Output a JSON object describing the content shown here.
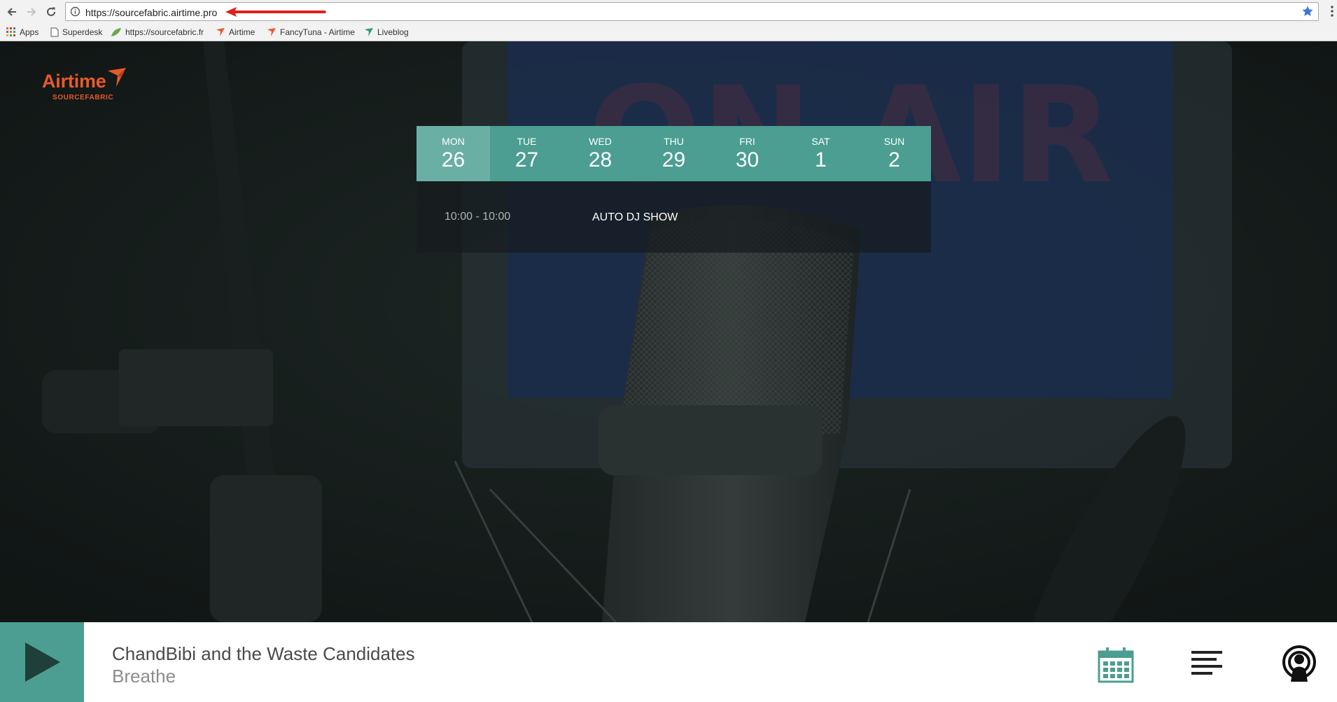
{
  "browser": {
    "url": "https://sourcefabric.airtime.pro",
    "bookmarks": [
      {
        "label": "Apps",
        "icon": "apps-grid-icon"
      },
      {
        "label": "Superdesk",
        "icon": "page-icon"
      },
      {
        "label": "https://sourcefabric.fr",
        "icon": "leaf-icon"
      },
      {
        "label": "Airtime",
        "icon": "airtime-icon"
      },
      {
        "label": "FancyTuna - Airtime",
        "icon": "airtime-icon"
      },
      {
        "label": "Liveblog",
        "icon": "liveblog-icon"
      }
    ]
  },
  "logo": {
    "name": "Airtime",
    "sub": "SOURCEFABRIC"
  },
  "week": [
    {
      "day": "MON",
      "date": "26",
      "active": true
    },
    {
      "day": "TUE",
      "date": "27"
    },
    {
      "day": "WED",
      "date": "28"
    },
    {
      "day": "THU",
      "date": "29"
    },
    {
      "day": "FRI",
      "date": "30"
    },
    {
      "day": "SAT",
      "date": "1"
    },
    {
      "day": "SUN",
      "date": "2"
    }
  ],
  "schedule": {
    "time": "10:00 - 10:00",
    "show": "AUTO DJ SHOW"
  },
  "player": {
    "artist": "ChandBibi and the Waste Candidates",
    "track": "Breathe",
    "icons": [
      "play-icon",
      "calendar-icon",
      "menu-lines-icon",
      "podcast-icon"
    ]
  },
  "colors": {
    "accent": "#4b9e91",
    "brand": "#e8592a",
    "annotation_arrow": "#e0201b"
  }
}
